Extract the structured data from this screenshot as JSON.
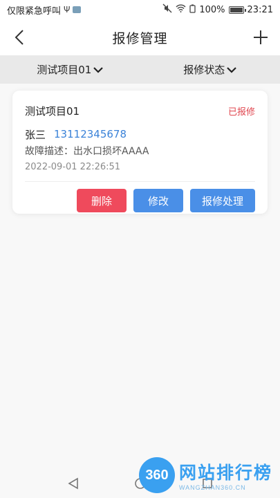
{
  "status_bar": {
    "left_text": "仅限紧急呼叫",
    "battery": "100%",
    "time": "23:21"
  },
  "header": {
    "title": "报修管理"
  },
  "filters": [
    {
      "label": "测试项目01"
    },
    {
      "label": "报修状态"
    }
  ],
  "cards": [
    {
      "project": "测试项目01",
      "status": "已报修",
      "person": "张三",
      "phone": "13112345678",
      "description_label": "故障描述：",
      "description": "出水口损坏AAAA",
      "time": "2022-09-01 22:26:51",
      "actions": {
        "delete": "删除",
        "edit": "修改",
        "process": "报修处理"
      }
    }
  ],
  "watermark": {
    "logo": "360",
    "main": "网站排行榜",
    "sub": "WANGZHAN360.CN"
  },
  "colors": {
    "accent_blue": "#4a8fe7",
    "danger_red": "#ef4a5c",
    "status_red": "#e0464f",
    "phone_blue": "#3a82d8"
  }
}
